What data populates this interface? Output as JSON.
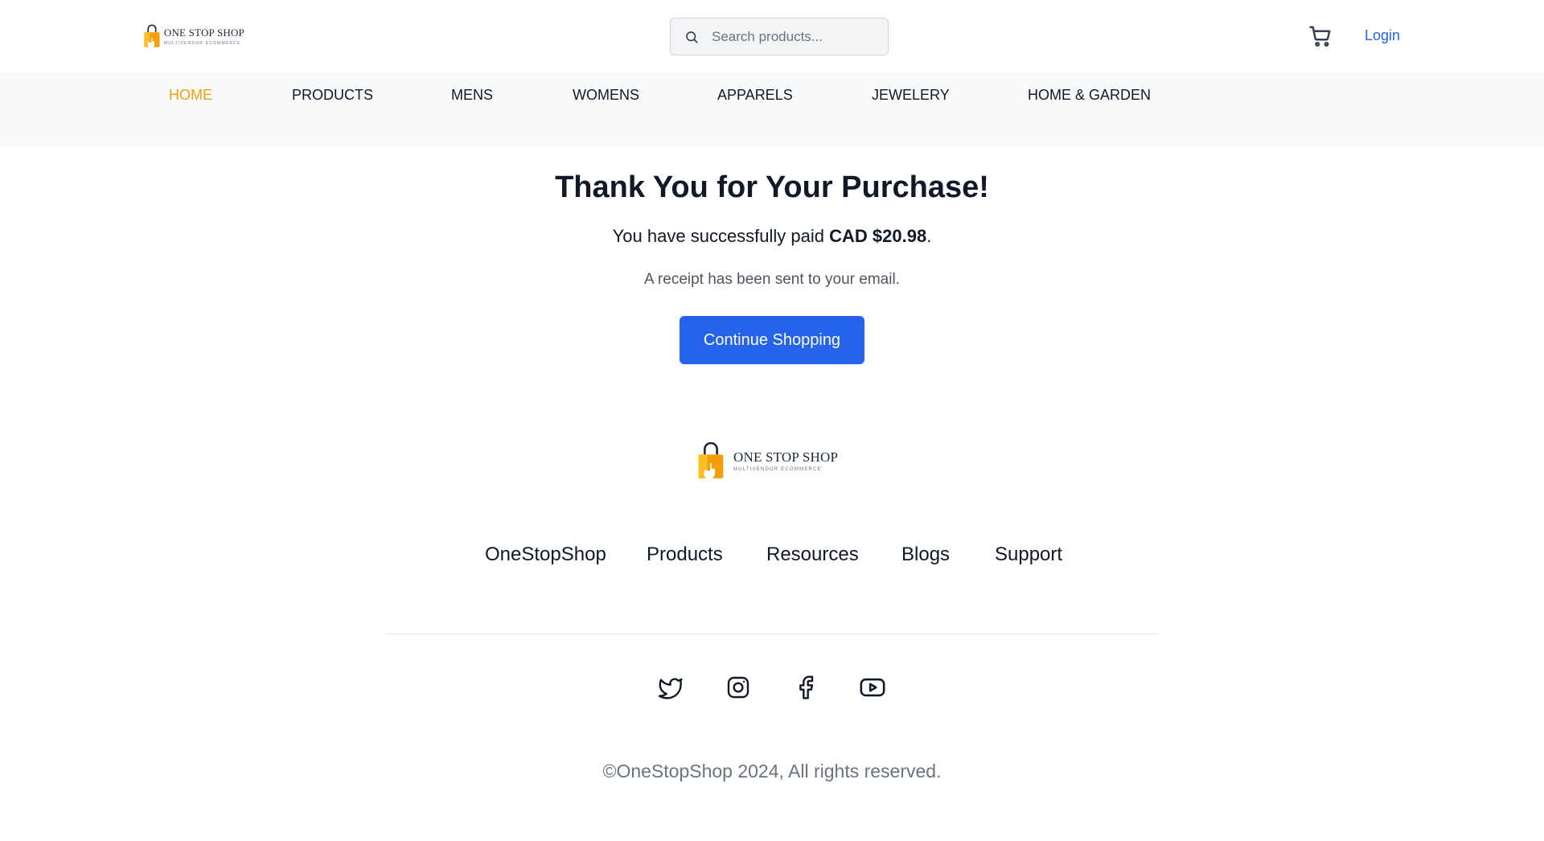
{
  "header": {
    "logo": {
      "main_text": "ONE STOP SHOP",
      "sub_text": "MULTIVENDOR ECOMMERCE"
    },
    "search": {
      "placeholder": "Search products...",
      "value": ""
    },
    "login_label": "Login"
  },
  "nav": {
    "items": [
      {
        "label": "HOME",
        "active": true
      },
      {
        "label": "PRODUCTS",
        "active": false
      },
      {
        "label": "MENS",
        "active": false
      },
      {
        "label": "WOMENS",
        "active": false
      },
      {
        "label": "APPARELS",
        "active": false
      },
      {
        "label": "JEWELERY",
        "active": false
      },
      {
        "label": "HOME & GARDEN",
        "active": false
      }
    ]
  },
  "main": {
    "title": "Thank You for Your Purchase!",
    "paid_prefix": "You have successfully paid ",
    "paid_amount": "CAD $20.98",
    "paid_suffix": ".",
    "receipt_text": "A receipt has been sent to your email.",
    "continue_label": "Continue Shopping"
  },
  "footer": {
    "logo": {
      "main_text": "ONE STOP SHOP",
      "sub_text": "MULTIVENDOR ECOMMERCE"
    },
    "links": [
      "OneStopShop",
      "Products",
      "Resources",
      "Blogs",
      "Support"
    ],
    "social_icons": [
      "twitter-icon",
      "instagram-icon",
      "facebook-icon",
      "youtube-icon"
    ],
    "copyright": "©OneStopShop 2024, All rights reserved."
  },
  "colors": {
    "accent": "#f59e0b",
    "primary": "#2563eb",
    "nav_background": "#f9fafb",
    "text": "#111827",
    "muted_text": "#6b7280"
  }
}
